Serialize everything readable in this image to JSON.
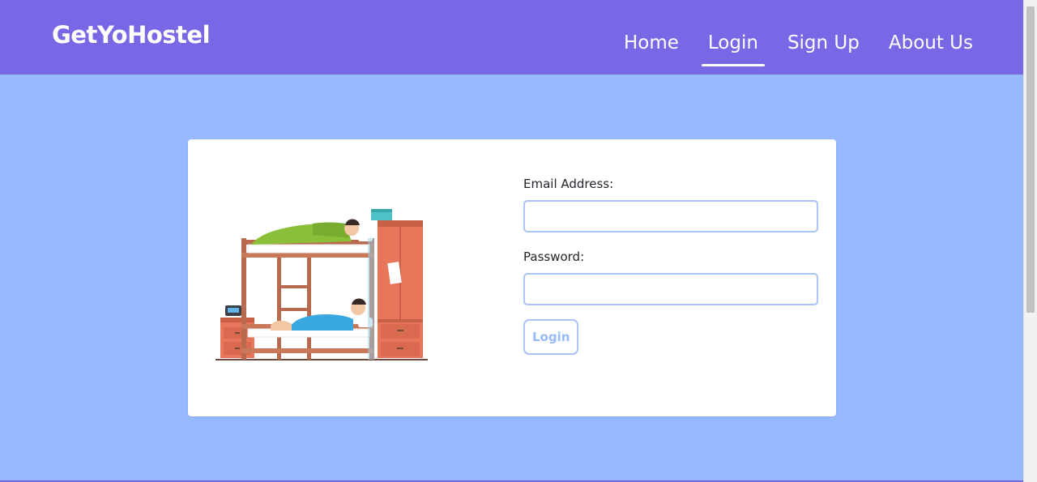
{
  "navbar": {
    "brand": "GetYoHostel",
    "links": [
      {
        "label": "Home",
        "active": false
      },
      {
        "label": "Login",
        "active": true
      },
      {
        "label": "Sign Up",
        "active": false
      },
      {
        "label": "About Us",
        "active": false
      }
    ]
  },
  "login_form": {
    "email_label": "Email Address:",
    "email_value": "",
    "password_label": "Password:",
    "password_value": "",
    "submit_label": "Login"
  },
  "colors": {
    "navbar": "#7868e6",
    "background": "#96b9ff",
    "input_border": "#a9c4f5",
    "card": "#ffffff"
  },
  "icons": {
    "illustration": "bunk-bed-hostel-illustration"
  }
}
